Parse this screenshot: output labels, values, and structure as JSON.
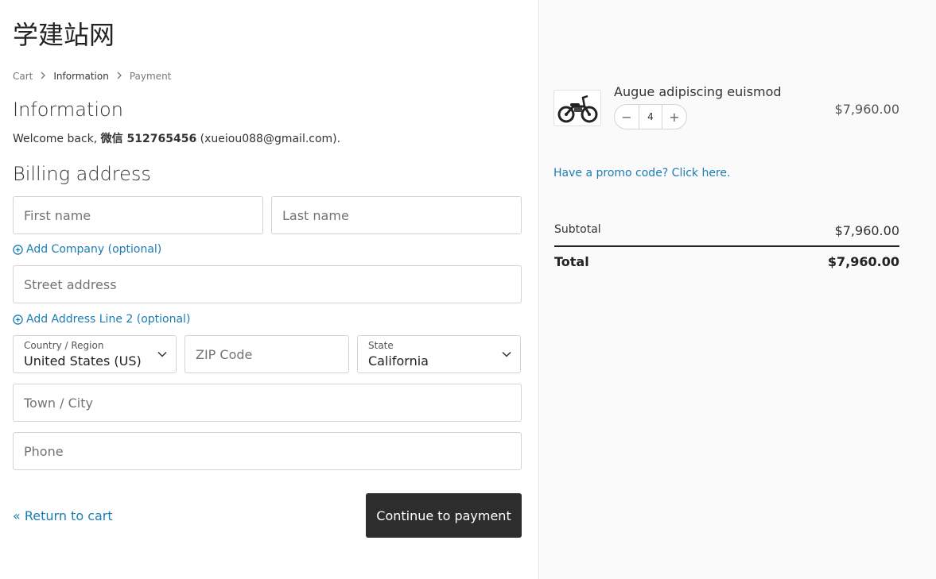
{
  "site": {
    "logo_text": "学建站网"
  },
  "breadcrumb": {
    "items": [
      "Cart",
      "Information",
      "Payment"
    ],
    "separator": ">"
  },
  "info": {
    "heading": "Information",
    "welcome_prefix": "Welcome back, ",
    "user_name": "微信 512765456",
    "user_email": " (xueiou088@gmail.com)."
  },
  "billing": {
    "heading": "Billing address",
    "first_name_placeholder": "First name",
    "last_name_placeholder": "Last name",
    "add_company": "Add Company (optional)",
    "street_placeholder": "Street address",
    "add_address_line2": "Add Address Line 2 (optional)",
    "country_label": "Country / Region",
    "country_value": "United States (US)",
    "zip_placeholder": "ZIP Code",
    "state_label": "State",
    "state_value": "California",
    "city_placeholder": "Town / City",
    "phone_placeholder": "Phone"
  },
  "actions": {
    "return_label": "« Return to cart",
    "continue_label": "Continue to payment"
  },
  "summary": {
    "product_name": "Augue adipiscing euismod",
    "quantity": "4",
    "decrement": "−",
    "increment": "+",
    "product_price": "$7,960.00",
    "promo_link": "Have a promo code? Click here.",
    "subtotal_label": "Subtotal",
    "subtotal_value": "$7,960.00",
    "total_label": "Total",
    "total_value": "$7,960.00"
  },
  "colors": {
    "link": "#1b7cb4",
    "button_bg": "#2d2d2d",
    "sidebar_bg": "#fafafa"
  },
  "icons": {
    "add": "circle-plus-icon",
    "select": "chevron-down-icon",
    "breadcrumb_sep": "chevron-right-icon"
  }
}
